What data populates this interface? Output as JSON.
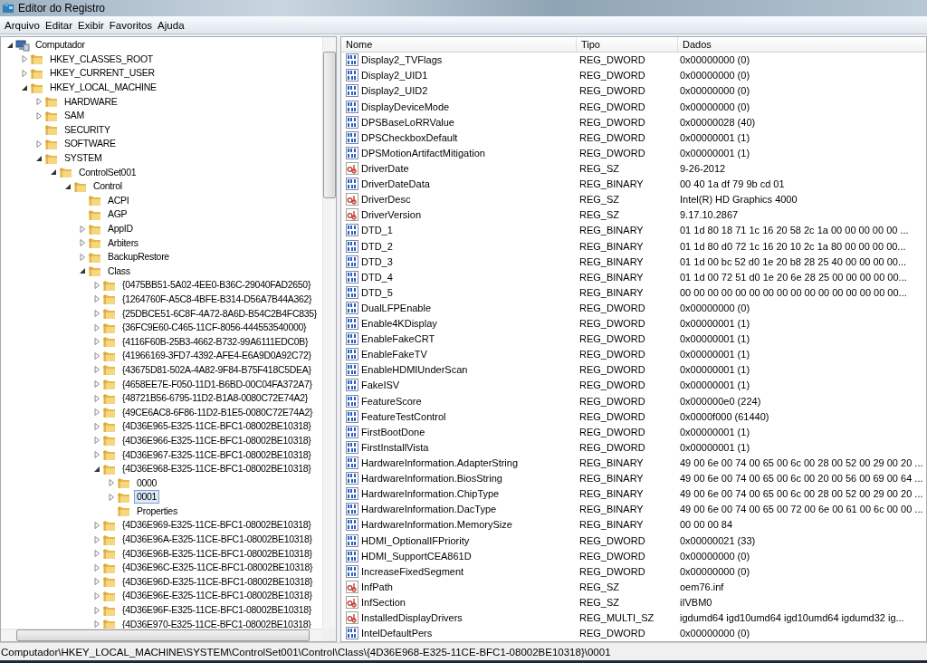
{
  "window": {
    "title": "Editor do Registro"
  },
  "menu": [
    "Arquivo",
    "Editar",
    "Exibir",
    "Favoritos",
    "Ajuda"
  ],
  "tree": [
    {
      "label": "Computador",
      "kind": "computer",
      "expanded": true,
      "selected": false,
      "children": [
        {
          "label": "HKEY_CLASSES_ROOT",
          "kind": "folder",
          "expanded": false,
          "selected": false
        },
        {
          "label": "HKEY_CURRENT_USER",
          "kind": "folder",
          "expanded": false,
          "selected": false
        },
        {
          "label": "HKEY_LOCAL_MACHINE",
          "kind": "folder",
          "expanded": true,
          "selected": false,
          "children": [
            {
              "label": "HARDWARE",
              "kind": "folder",
              "expanded": false,
              "selected": false
            },
            {
              "label": "SAM",
              "kind": "folder",
              "expanded": false,
              "selected": false
            },
            {
              "label": "SECURITY",
              "kind": "folder",
              "selected": false
            },
            {
              "label": "SOFTWARE",
              "kind": "folder",
              "expanded": false,
              "selected": false
            },
            {
              "label": "SYSTEM",
              "kind": "folder",
              "expanded": true,
              "selected": false,
              "children": [
                {
                  "label": "ControlSet001",
                  "kind": "folder",
                  "expanded": true,
                  "selected": false,
                  "children": [
                    {
                      "label": "Control",
                      "kind": "folder",
                      "expanded": true,
                      "selected": false,
                      "children": [
                        {
                          "label": "ACPI",
                          "kind": "folder",
                          "selected": false
                        },
                        {
                          "label": "AGP",
                          "kind": "folder",
                          "selected": false
                        },
                        {
                          "label": "AppID",
                          "kind": "folder",
                          "expanded": false,
                          "selected": false
                        },
                        {
                          "label": "Arbiters",
                          "kind": "folder",
                          "expanded": false,
                          "selected": false
                        },
                        {
                          "label": "BackupRestore",
                          "kind": "folder",
                          "expanded": false,
                          "selected": false
                        },
                        {
                          "label": "Class",
                          "kind": "folder",
                          "expanded": true,
                          "selected": false,
                          "children": [
                            {
                              "label": "{0475BB51-5A02-4EE0-B36C-29040FAD2650}",
                              "kind": "folder",
                              "expanded": false,
                              "selected": false
                            },
                            {
                              "label": "{1264760F-A5C8-4BFE-B314-D56A7B44A362}",
                              "kind": "folder",
                              "expanded": false,
                              "selected": false
                            },
                            {
                              "label": "{25DBCE51-6C8F-4A72-8A6D-B54C2B4FC835}",
                              "kind": "folder",
                              "expanded": false,
                              "selected": false
                            },
                            {
                              "label": "{36FC9E60-C465-11CF-8056-444553540000}",
                              "kind": "folder",
                              "expanded": false,
                              "selected": false
                            },
                            {
                              "label": "{4116F60B-25B3-4662-B732-99A6111EDC0B}",
                              "kind": "folder",
                              "expanded": false,
                              "selected": false
                            },
                            {
                              "label": "{41966169-3FD7-4392-AFE4-E6A9D0A92C72}",
                              "kind": "folder",
                              "expanded": false,
                              "selected": false
                            },
                            {
                              "label": "{43675D81-502A-4A82-9F84-B75F418C5DEA}",
                              "kind": "folder",
                              "expanded": false,
                              "selected": false
                            },
                            {
                              "label": "{4658EE7E-F050-11D1-B6BD-00C04FA372A7}",
                              "kind": "folder",
                              "expanded": false,
                              "selected": false
                            },
                            {
                              "label": "{48721B56-6795-11D2-B1A8-0080C72E74A2}",
                              "kind": "folder",
                              "expanded": false,
                              "selected": false
                            },
                            {
                              "label": "{49CE6AC8-6F86-11D2-B1E5-0080C72E74A2}",
                              "kind": "folder",
                              "expanded": false,
                              "selected": false
                            },
                            {
                              "label": "{4D36E965-E325-11CE-BFC1-08002BE10318}",
                              "kind": "folder",
                              "expanded": false,
                              "selected": false
                            },
                            {
                              "label": "{4D36E966-E325-11CE-BFC1-08002BE10318}",
                              "kind": "folder",
                              "expanded": false,
                              "selected": false
                            },
                            {
                              "label": "{4D36E967-E325-11CE-BFC1-08002BE10318}",
                              "kind": "folder",
                              "expanded": false,
                              "selected": false
                            },
                            {
                              "label": "{4D36E968-E325-11CE-BFC1-08002BE10318}",
                              "kind": "folder",
                              "expanded": true,
                              "selected": false,
                              "children": [
                                {
                                  "label": "0000",
                                  "kind": "folder",
                                  "expanded": false,
                                  "selected": false
                                },
                                {
                                  "label": "0001",
                                  "kind": "folder",
                                  "expanded": false,
                                  "selected": true
                                },
                                {
                                  "label": "Properties",
                                  "kind": "folder",
                                  "selected": false
                                }
                              ]
                            },
                            {
                              "label": "{4D36E969-E325-11CE-BFC1-08002BE10318}",
                              "kind": "folder",
                              "expanded": false,
                              "selected": false
                            },
                            {
                              "label": "{4D36E96A-E325-11CE-BFC1-08002BE10318}",
                              "kind": "folder",
                              "expanded": false,
                              "selected": false
                            },
                            {
                              "label": "{4D36E96B-E325-11CE-BFC1-08002BE10318}",
                              "kind": "folder",
                              "expanded": false,
                              "selected": false
                            },
                            {
                              "label": "{4D36E96C-E325-11CE-BFC1-08002BE10318}",
                              "kind": "folder",
                              "expanded": false,
                              "selected": false
                            },
                            {
                              "label": "{4D36E96D-E325-11CE-BFC1-08002BE10318}",
                              "kind": "folder",
                              "expanded": false,
                              "selected": false
                            },
                            {
                              "label": "{4D36E96E-E325-11CE-BFC1-08002BE10318}",
                              "kind": "folder",
                              "expanded": false,
                              "selected": false
                            },
                            {
                              "label": "{4D36E96F-E325-11CE-BFC1-08002BE10318}",
                              "kind": "folder",
                              "expanded": false,
                              "selected": false
                            },
                            {
                              "label": "{4D36E970-E325-11CE-BFC1-08002BE10318}",
                              "kind": "folder",
                              "expanded": false,
                              "selected": false
                            }
                          ]
                        }
                      ]
                    }
                  ]
                }
              ]
            }
          ]
        }
      ]
    }
  ],
  "table": {
    "columns": [
      "Nome",
      "Tipo",
      "Dados"
    ],
    "rows": [
      {
        "name": "Display2_TVFlags",
        "type": "REG_DWORD",
        "data": "0x00000000 (0)",
        "kind": "binary"
      },
      {
        "name": "Display2_UID1",
        "type": "REG_DWORD",
        "data": "0x00000000 (0)",
        "kind": "binary"
      },
      {
        "name": "Display2_UID2",
        "type": "REG_DWORD",
        "data": "0x00000000 (0)",
        "kind": "binary"
      },
      {
        "name": "DisplayDeviceMode",
        "type": "REG_DWORD",
        "data": "0x00000000 (0)",
        "kind": "binary"
      },
      {
        "name": "DPSBaseLoRRValue",
        "type": "REG_DWORD",
        "data": "0x00000028 (40)",
        "kind": "binary"
      },
      {
        "name": "DPSCheckboxDefault",
        "type": "REG_DWORD",
        "data": "0x00000001 (1)",
        "kind": "binary"
      },
      {
        "name": "DPSMotionArtifactMitigation",
        "type": "REG_DWORD",
        "data": "0x00000001 (1)",
        "kind": "binary"
      },
      {
        "name": "DriverDate",
        "type": "REG_SZ",
        "data": "9-26-2012",
        "kind": "string"
      },
      {
        "name": "DriverDateData",
        "type": "REG_BINARY",
        "data": "00 40 1a df 79 9b cd 01",
        "kind": "binary"
      },
      {
        "name": "DriverDesc",
        "type": "REG_SZ",
        "data": "Intel(R) HD Graphics 4000",
        "kind": "string"
      },
      {
        "name": "DriverVersion",
        "type": "REG_SZ",
        "data": "9.17.10.2867",
        "kind": "string"
      },
      {
        "name": "DTD_1",
        "type": "REG_BINARY",
        "data": "01 1d 80 18 71 1c 16 20 58 2c 1a 00 00 00 00 00 ...",
        "kind": "binary"
      },
      {
        "name": "DTD_2",
        "type": "REG_BINARY",
        "data": "01 1d 80 d0 72 1c 16 20 10 2c 1a 80 00 00 00 00...",
        "kind": "binary"
      },
      {
        "name": "DTD_3",
        "type": "REG_BINARY",
        "data": "01 1d 00 bc 52 d0 1e 20 b8 28 25 40 00 00 00 00...",
        "kind": "binary"
      },
      {
        "name": "DTD_4",
        "type": "REG_BINARY",
        "data": "01 1d 00 72 51 d0 1e 20 6e 28 25 00 00 00 00 00...",
        "kind": "binary"
      },
      {
        "name": "DTD_5",
        "type": "REG_BINARY",
        "data": "00 00 00 00 00 00 00 00 00 00 00 00 00 00 00 00...",
        "kind": "binary"
      },
      {
        "name": "DualLFPEnable",
        "type": "REG_DWORD",
        "data": "0x00000000 (0)",
        "kind": "binary"
      },
      {
        "name": "Enable4KDisplay",
        "type": "REG_DWORD",
        "data": "0x00000001 (1)",
        "kind": "binary"
      },
      {
        "name": "EnableFakeCRT",
        "type": "REG_DWORD",
        "data": "0x00000001 (1)",
        "kind": "binary"
      },
      {
        "name": "EnableFakeTV",
        "type": "REG_DWORD",
        "data": "0x00000001 (1)",
        "kind": "binary"
      },
      {
        "name": "EnableHDMIUnderScan",
        "type": "REG_DWORD",
        "data": "0x00000001 (1)",
        "kind": "binary"
      },
      {
        "name": "FakeISV",
        "type": "REG_DWORD",
        "data": "0x00000001 (1)",
        "kind": "binary"
      },
      {
        "name": "FeatureScore",
        "type": "REG_DWORD",
        "data": "0x000000e0 (224)",
        "kind": "binary"
      },
      {
        "name": "FeatureTestControl",
        "type": "REG_DWORD",
        "data": "0x0000f000 (61440)",
        "kind": "binary"
      },
      {
        "name": "FirstBootDone",
        "type": "REG_DWORD",
        "data": "0x00000001 (1)",
        "kind": "binary"
      },
      {
        "name": "FirstInstallVista",
        "type": "REG_DWORD",
        "data": "0x00000001 (1)",
        "kind": "binary"
      },
      {
        "name": "HardwareInformation.AdapterString",
        "type": "REG_BINARY",
        "data": "49 00 6e 00 74 00 65 00 6c 00 28 00 52 00 29 00 20 ...",
        "kind": "binary"
      },
      {
        "name": "HardwareInformation.BiosString",
        "type": "REG_BINARY",
        "data": "49 00 6e 00 74 00 65 00 6c 00 20 00 56 00 69 00 64 ...",
        "kind": "binary"
      },
      {
        "name": "HardwareInformation.ChipType",
        "type": "REG_BINARY",
        "data": "49 00 6e 00 74 00 65 00 6c 00 28 00 52 00 29 00 20 ...",
        "kind": "binary"
      },
      {
        "name": "HardwareInformation.DacType",
        "type": "REG_BINARY",
        "data": "49 00 6e 00 74 00 65 00 72 00 6e 00 61 00 6c 00 00 ...",
        "kind": "binary"
      },
      {
        "name": "HardwareInformation.MemorySize",
        "type": "REG_BINARY",
        "data": "00 00 00 84",
        "kind": "binary"
      },
      {
        "name": "HDMI_OptionalIFPriority",
        "type": "REG_DWORD",
        "data": "0x00000021 (33)",
        "kind": "binary"
      },
      {
        "name": "HDMI_SupportCEA861D",
        "type": "REG_DWORD",
        "data": "0x00000000 (0)",
        "kind": "binary"
      },
      {
        "name": "IncreaseFixedSegment",
        "type": "REG_DWORD",
        "data": "0x00000000 (0)",
        "kind": "binary"
      },
      {
        "name": "InfPath",
        "type": "REG_SZ",
        "data": "oem76.inf",
        "kind": "string"
      },
      {
        "name": "InfSection",
        "type": "REG_SZ",
        "data": "iIVBM0",
        "kind": "string"
      },
      {
        "name": "InstalledDisplayDrivers",
        "type": "REG_MULTI_SZ",
        "data": "igdumd64 igd10umd64 igd10umd64 igdumd32 ig...",
        "kind": "string"
      },
      {
        "name": "IntelDefaultPers",
        "type": "REG_DWORD",
        "data": "0x00000000 (0)",
        "kind": "binary"
      }
    ]
  },
  "status_bar": "Computador\\HKEY_LOCAL_MACHINE\\SYSTEM\\ControlSet001\\Control\\Class\\{4D36E968-E325-11CE-BFC1-08002BE10318}\\0001"
}
